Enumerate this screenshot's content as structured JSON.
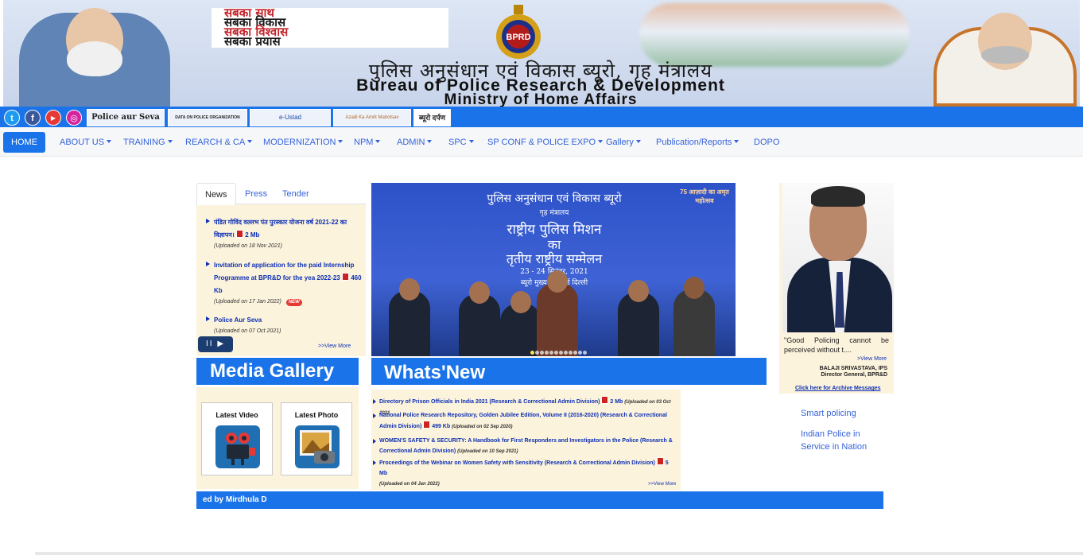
{
  "banner": {
    "slogan": [
      "सबका साथ",
      "सबका विकास",
      "सबका विश्वास",
      "सबका प्रयास"
    ],
    "emblem_text": "BPRD",
    "title_hindi": "पुलिस अनुसंधान एवं विकास ब्यूरो, गृह मंत्रालय",
    "title_english": "Bureau of Police Research & Development",
    "title_ministry": "Ministry of Home Affairs"
  },
  "quickbar": {
    "social": [
      {
        "name": "twitter",
        "glyph": "t",
        "color": "#1d9bf0"
      },
      {
        "name": "facebook",
        "glyph": "f",
        "color": "#3b5998"
      },
      {
        "name": "youtube",
        "glyph": "▶",
        "color": "#e53935"
      },
      {
        "name": "instagram",
        "glyph": "◎",
        "color": "#d6249f"
      }
    ],
    "links": [
      "Police aur Seva",
      "DATA ON POLICE ORGANIZATION",
      "e-Ustad",
      "Azadi Ka Amrit Mahotsav",
      "ब्यूरो दर्पण"
    ]
  },
  "nav": {
    "items": [
      {
        "label": "HOME",
        "dropdown": false
      },
      {
        "label": "ABOUT US",
        "dropdown": true
      },
      {
        "label": "TRAINING",
        "dropdown": true
      },
      {
        "label": "REARCH & CA",
        "dropdown": true
      },
      {
        "label": "MODERNIZATION",
        "dropdown": true
      },
      {
        "label": "NPM",
        "dropdown": true
      },
      {
        "label": "ADMIN",
        "dropdown": true
      },
      {
        "label": "SPC",
        "dropdown": true
      },
      {
        "label": "SP CONF & POLICE EXPO",
        "dropdown": true
      },
      {
        "label": "Gallery",
        "dropdown": true
      },
      {
        "label": "Publication/Reports",
        "dropdown": true
      },
      {
        "label": "DOPO",
        "dropdown": false
      }
    ]
  },
  "news": {
    "tabs": [
      "News",
      "Press",
      "Tender"
    ],
    "items": [
      {
        "text": "पंडित गोविंद वल्लभ पंत पुरस्कार योजना वर्ष 2021-22 का विज्ञापन।",
        "size": "2 Mb",
        "uploaded": "(Uploaded on 18 Nov 2021)"
      },
      {
        "text": "Invitation of application for the paid Internship Programme at BPR&D for the yea 2022-23",
        "size": "460 Kb",
        "uploaded": "(Uploaded on 17 Jan 2022)",
        "badge": "NEW"
      },
      {
        "text": "Police Aur Seva",
        "uploaded": "(Uploaded on 07 Oct 2021)"
      }
    ],
    "view_more": ">>View More",
    "player_label": "II ▶"
  },
  "slider": {
    "line1": "पुलिस अनुसंधान एवं विकास ब्यूरो",
    "line2": "गृह मंत्रालय",
    "line3": "राष्ट्रीय पुलिस मिशन",
    "line4": "का",
    "line5": "तृतीय राष्ट्रीय सम्मेलन",
    "line6": "23 - 24 सितंबर, 2021",
    "line7": "ब्यूरो मुख्यालय, नई दिल्ली",
    "logo": "75 आज़ादी का अमृत महोत्सव",
    "active_dot": 0,
    "dot_count": 12
  },
  "director": {
    "quote": "\"Good Policing cannot be perceived without t....",
    "view_more": ">View More",
    "name": "BALAJI SRIVASTAVA, IPS",
    "title": "Director General, BPR&D",
    "archive_link": "Click here for Archive Messages"
  },
  "media": {
    "heading": "Media Gallery",
    "cards": [
      {
        "label": "Latest Video",
        "icon": "video-camera-icon"
      },
      {
        "label": "Latest Photo",
        "icon": "photo-camera-icon"
      }
    ]
  },
  "whats_new": {
    "heading": "Whats'New",
    "items": [
      {
        "text": "Directory of Prison Officials in India 2021 (Research & Correctional Admin Division)",
        "size": "2 Mb",
        "uploaded": "(Uploaded on 03 Oct 2021"
      },
      {
        "text": "National Police Research Repository, Golden Jubilee Edition, Volume II (2016-2020) (Research & Correctional Admin Division)",
        "size": "499 Kb",
        "uploaded": "(Uploaded on 02 Sep 2020)"
      },
      {
        "text": "WOMEN'S SAFETY & SECURITY: A Handbook for First Responders and Investigators in the Police (Research & Correctional Admin Division)",
        "size": "",
        "uploaded": "(Uploaded on 10 Sep 2021)"
      },
      {
        "text": "Proceedings of the Webinar on Women Safety with Sensitivity (Research & Correctional Admin Division)",
        "size": "5 Mb",
        "uploaded": "(Uploaded on 04 Jan 2022)"
      }
    ],
    "view_more": ">>View More"
  },
  "right_links": [
    "Smart policing",
    "Indian Police in Service in Nation"
  ],
  "footer": {
    "marquee": "ed by Mirdhula D"
  },
  "colors": {
    "accent": "#1a73e8",
    "panel": "#fcf3dc",
    "link": "#0c2fb4"
  }
}
